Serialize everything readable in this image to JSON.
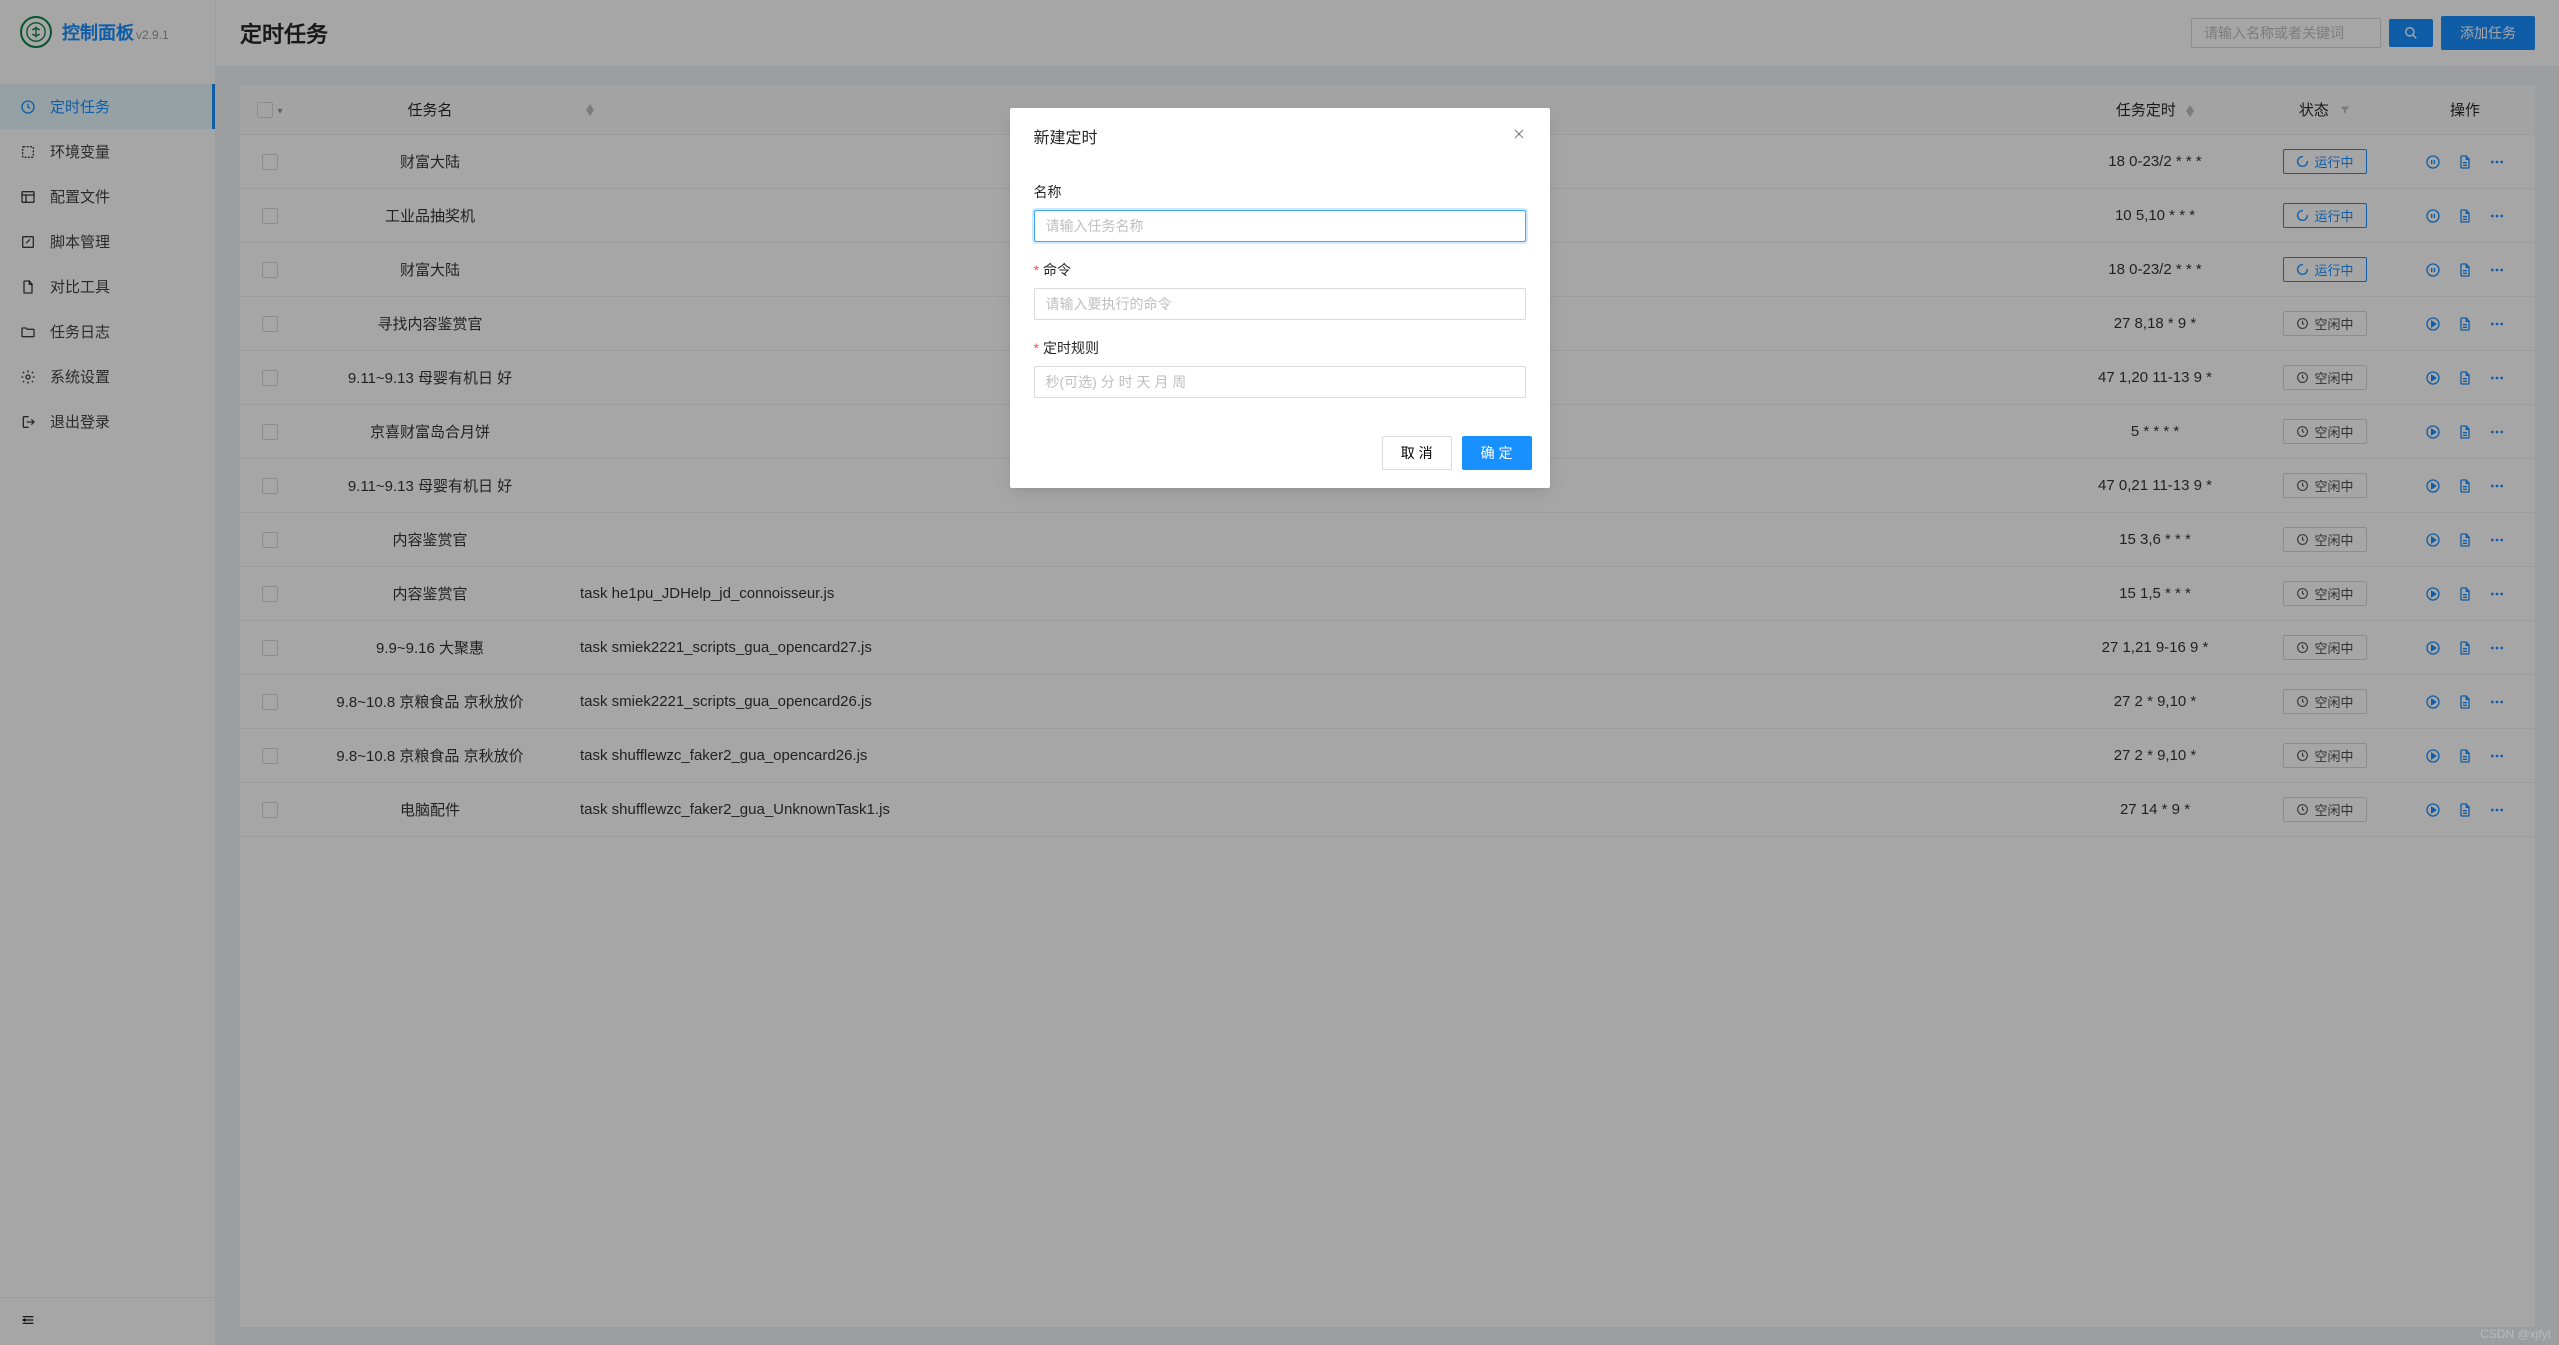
{
  "brand": {
    "name": "控制面板",
    "version": "v2.9.1"
  },
  "sidebar": {
    "items": [
      {
        "label": "定时任务"
      },
      {
        "label": "环境变量"
      },
      {
        "label": "配置文件"
      },
      {
        "label": "脚本管理"
      },
      {
        "label": "对比工具"
      },
      {
        "label": "任务日志"
      },
      {
        "label": "系统设置"
      },
      {
        "label": "退出登录"
      }
    ]
  },
  "header": {
    "title": "定时任务",
    "search_placeholder": "请输入名称或者关键词",
    "add_button": "添加任务"
  },
  "table": {
    "columns": {
      "name": "任务名",
      "schedule": "任务定时",
      "status": "状态",
      "actions": "操作"
    },
    "status_labels": {
      "running": "运行中",
      "idle": "空闲中"
    },
    "rows": [
      {
        "name": "财富大陆",
        "command": "",
        "schedule": "18 0-23/2 * * *",
        "status": "running"
      },
      {
        "name": "工业品抽奖机",
        "command": "",
        "schedule": "10 5,10 * * *",
        "status": "running"
      },
      {
        "name": "财富大陆",
        "command": "",
        "schedule": "18 0-23/2 * * *",
        "status": "running"
      },
      {
        "name": "寻找内容鉴赏官",
        "command": "",
        "schedule": "27 8,18 * 9 *",
        "status": "idle"
      },
      {
        "name": "9.11~9.13 母婴有机日 好",
        "command": "",
        "schedule": "47 1,20 11-13 9 *",
        "status": "idle"
      },
      {
        "name": "京喜财富岛合月饼",
        "command": "",
        "schedule": "5 * * * *",
        "status": "idle"
      },
      {
        "name": "9.11~9.13 母婴有机日 好",
        "command": "",
        "schedule": "47 0,21 11-13 9 *",
        "status": "idle"
      },
      {
        "name": "内容鉴赏官",
        "command": "",
        "schedule": "15 3,6 * * *",
        "status": "idle"
      },
      {
        "name": "内容鉴赏官",
        "command": "task he1pu_JDHelp_jd_connoisseur.js",
        "schedule": "15 1,5 * * *",
        "status": "idle"
      },
      {
        "name": "9.9~9.16 大聚惠",
        "command": "task smiek2221_scripts_gua_opencard27.js",
        "schedule": "27 1,21 9-16 9 *",
        "status": "idle"
      },
      {
        "name": "9.8~10.8 京粮食品 京秋放价",
        "command": "task smiek2221_scripts_gua_opencard26.js",
        "schedule": "27 2 * 9,10 *",
        "status": "idle"
      },
      {
        "name": "9.8~10.8 京粮食品 京秋放价",
        "command": "task shufflewzc_faker2_gua_opencard26.js",
        "schedule": "27 2 * 9,10 *",
        "status": "idle"
      },
      {
        "name": "电脑配件",
        "command": "task shufflewzc_faker2_gua_UnknownTask1.js",
        "schedule": "27 14 * 9 *",
        "status": "idle"
      }
    ]
  },
  "modal": {
    "title": "新建定时",
    "fields": {
      "name": {
        "label": "名称",
        "placeholder": "请输入任务名称",
        "required": false
      },
      "command": {
        "label": "命令",
        "placeholder": "请输入要执行的命令",
        "required": true
      },
      "cron": {
        "label": "定时规则",
        "placeholder": "秒(可选) 分 时 天 月 周",
        "required": true
      }
    },
    "buttons": {
      "cancel": "取 消",
      "ok": "确 定"
    }
  },
  "watermark": "CSDN @xjfyt"
}
